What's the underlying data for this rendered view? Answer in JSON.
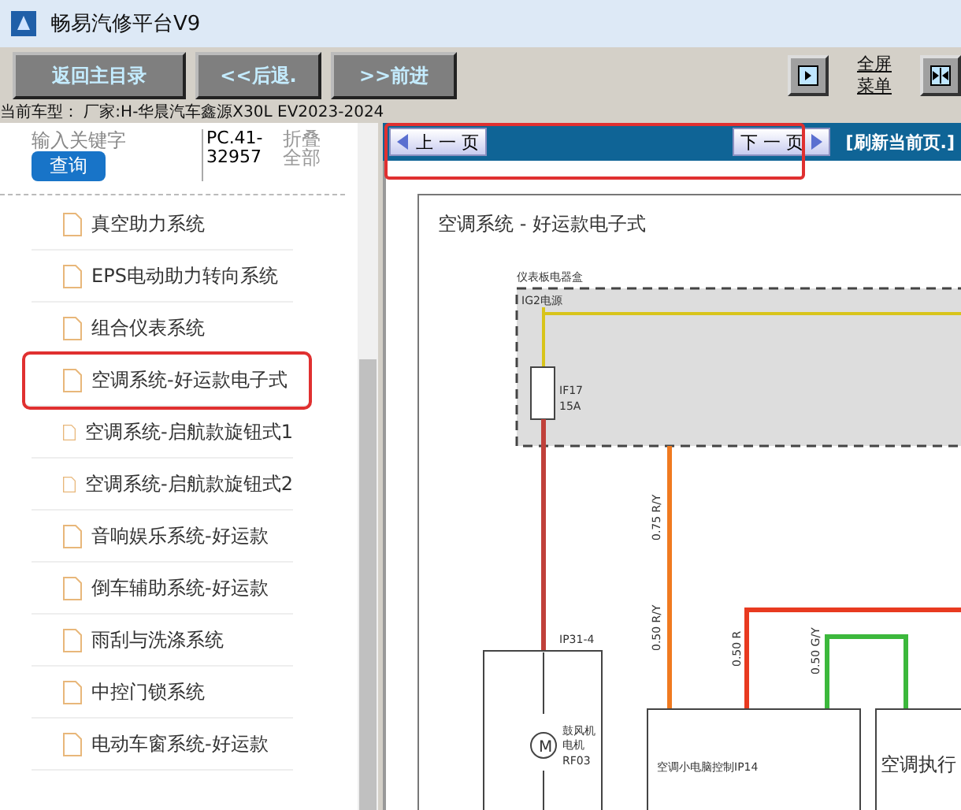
{
  "window": {
    "title": "畅易汽修平台V9"
  },
  "toolbar": {
    "buttons": [
      "返回主目录",
      "<<后退.",
      ">>前进"
    ],
    "fullscreen_menu": [
      "全屏",
      "菜单"
    ]
  },
  "vehicle_info": "当前车型：  厂家:H-华晨汽车鑫源X30L EV2023-2024",
  "sidebar": {
    "search": {
      "placeholder": "输入关键字"
    },
    "search_button": "查询",
    "code": "PC.41-32957",
    "collapse_all": "折叠全部",
    "items": [
      {
        "label": "真空助力系统",
        "selected": false
      },
      {
        "label": "EPS电动助力转向系统",
        "selected": false
      },
      {
        "label": "组合仪表系统",
        "selected": false
      },
      {
        "label": "空调系统-好运款电子式",
        "selected": true
      },
      {
        "label": "空调系统-启航款旋钮式1",
        "selected": false
      },
      {
        "label": "空调系统-启航款旋钮式2",
        "selected": false
      },
      {
        "label": "音响娱乐系统-好运款",
        "selected": false
      },
      {
        "label": "倒车辅助系统-好运款",
        "selected": false
      },
      {
        "label": "雨刮与洗涤系统",
        "selected": false
      },
      {
        "label": "中控门锁系统",
        "selected": false
      },
      {
        "label": "电动车窗系统-好运款",
        "selected": false
      }
    ]
  },
  "viewer": {
    "prev_page": "上 一 页",
    "next_page": "下 一 页",
    "refresh": "[刷新当前页.]",
    "highlighted": true
  },
  "diagram": {
    "title": "空调系统 - 好运款电子式",
    "labels": [
      "仪表板电器盒",
      "IG2电源",
      "IF17",
      "15A",
      "IP31-4",
      "0.75 R/Y",
      "0.50 R/Y",
      "0.50 R",
      "0.50 G/Y",
      "M",
      "鼓风机",
      "电机",
      "RF03",
      "空调小电脑控制IP14",
      "空调执行"
    ]
  }
}
